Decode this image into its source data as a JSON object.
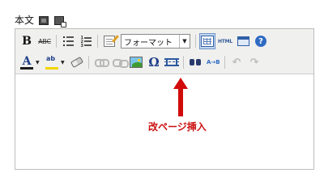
{
  "header": {
    "label": "本文"
  },
  "toolbar": {
    "format_select": {
      "value": "フォーマット"
    },
    "bold_label": "B",
    "strike_label": "ABC",
    "html_label": "HTML",
    "help_label": "?",
    "font_color_label": "A",
    "special_char_label": "Ω",
    "replace_label": "A→B",
    "undo_label": "↶",
    "redo_label": "↷",
    "ordered_list_numbers": [
      "1",
      "2",
      "3"
    ]
  },
  "annotation": {
    "text": "改ページ挿入",
    "color": "#cc1111",
    "arrow_color": "#d10a0a"
  }
}
